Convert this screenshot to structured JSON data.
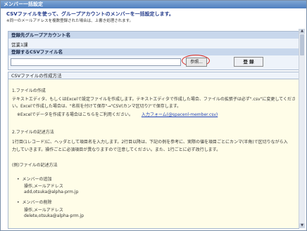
{
  "window": {
    "title": "メンバー一括設定"
  },
  "intro": {
    "heading": "CSVファイルを使って、グループアカウントのメンバーを一括設定します。",
    "note": "※同一のメールアドレスを複数登録された場合は、上書き処理されます。"
  },
  "form": {
    "group_label": "登録先グループアカウント名",
    "group_value": "営業1課",
    "csv_label": "登録するCSVファイル名",
    "browse_label": "参照...",
    "register_label": "登 録"
  },
  "help": {
    "header": "CSVファイルの作成方法",
    "s1_title": "1.ファイルの作成",
    "s1_line1": "テキストエディタ、もしくはExcelで設定ファイルを作成します。テキストエディタで作成した場合、ファイルの拡張子は必ず\".csv\"に変更してくださ",
    "s1_line2": "い。Excelで作成した場合は、\"名前を付けて保存\"→\"CSV(カンマ区切り)\"で保存します。",
    "s1_excel_prefix": "※Excelでデータを作成する場合はこちらをご利用ください。",
    "s1_excel_link": "入力フォーム(@spacenl-member.csv)",
    "s2_title": "2.ファイルの記述方法",
    "s2_line1": "1行目(1レコード)に、ヘッダとして項目名を入力します。2行目以降は、下記の例を参考に、実際の値を項目ごとにカンマ(半角)で区切りながら入",
    "s2_line2": "力していきます。操作ごとに必須項目が異なりますので注意してください。また、1行ごとに必ず改行します。",
    "example_title": "(例)ファイルの記述方法",
    "ex1_title": "メンバーの追加",
    "ex1_header": "操作,メールアドレス",
    "ex1_value": "add,otsuka@alpha-prm.jp",
    "ex2_title": "メンバーの削除",
    "ex2_header": "操作,メールアドレス",
    "ex2_value": "delete,otsuka@alpha-prm.jp"
  }
}
